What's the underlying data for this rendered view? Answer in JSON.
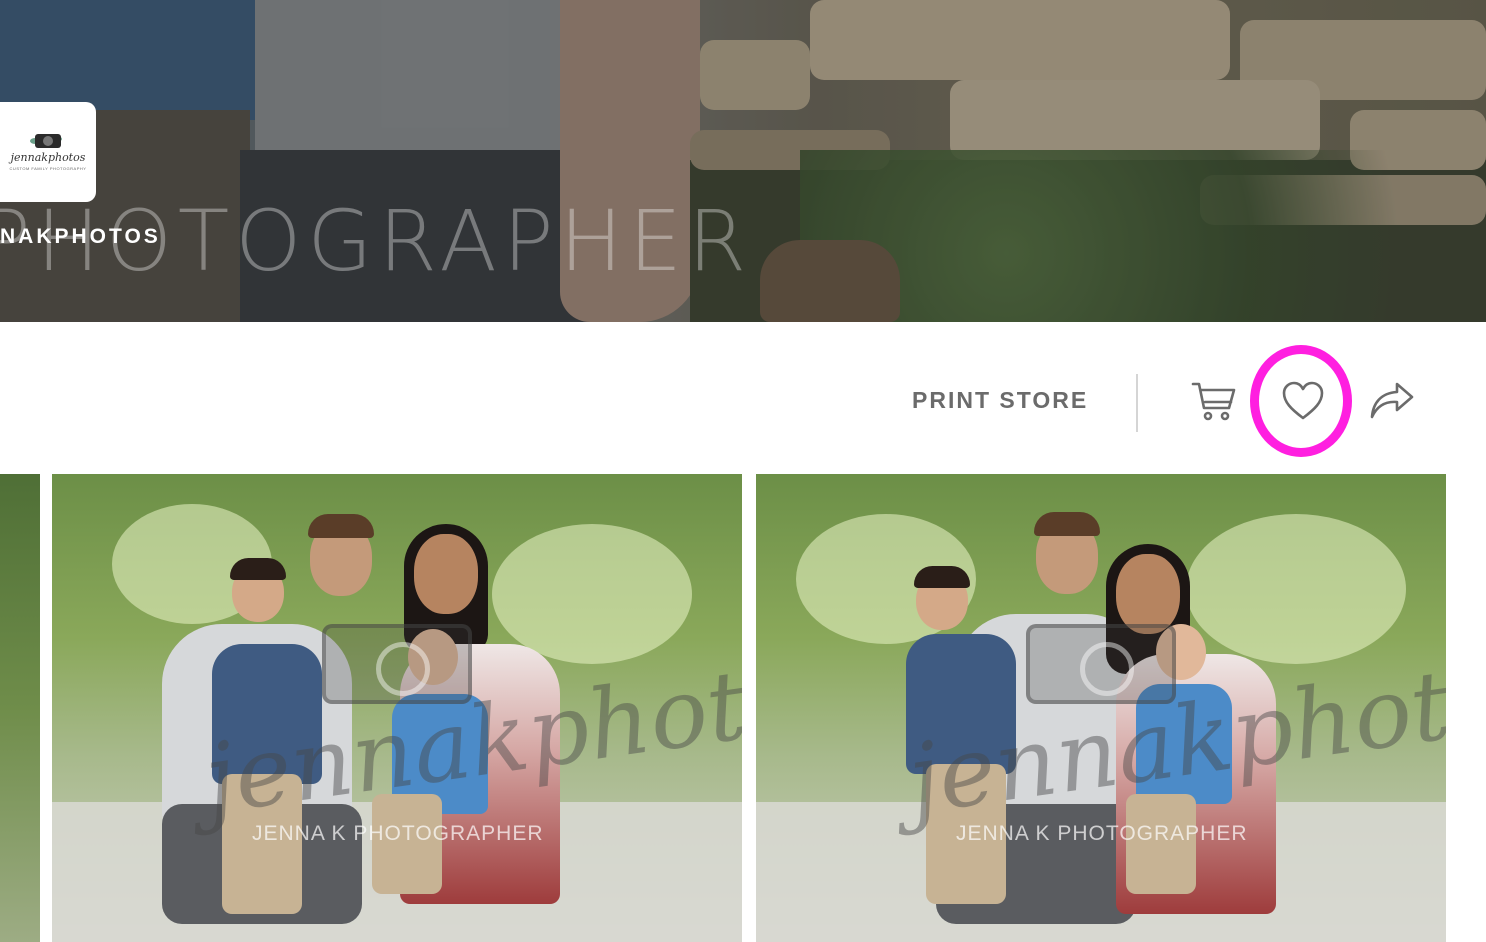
{
  "hero": {
    "studio_name": "NAKPHOTOS",
    "watermark_text": "PHOTOGRAPHER",
    "logo": {
      "wordmark": "jennakphotos",
      "tagline": "CUSTOM FAMILY PHOTOGRAPHY"
    }
  },
  "toolbar": {
    "print_store_label": "PRINT STORE",
    "icons": {
      "cart": "cart-icon",
      "favorite": "heart-icon",
      "share": "share-arrow-icon"
    },
    "highlight_color": "#ff1fe0"
  },
  "gallery": {
    "watermark": {
      "script": "jennakphotos",
      "subtitle": "JENNA K PHOTOGRAPHER"
    },
    "photos": [
      {
        "alt": "Family portrait photo 1"
      },
      {
        "alt": "Family portrait photo 2"
      }
    ]
  },
  "colors": {
    "text_muted": "#6b6b6b",
    "divider": "#d5d5d5",
    "highlight": "#ff1fe0"
  }
}
